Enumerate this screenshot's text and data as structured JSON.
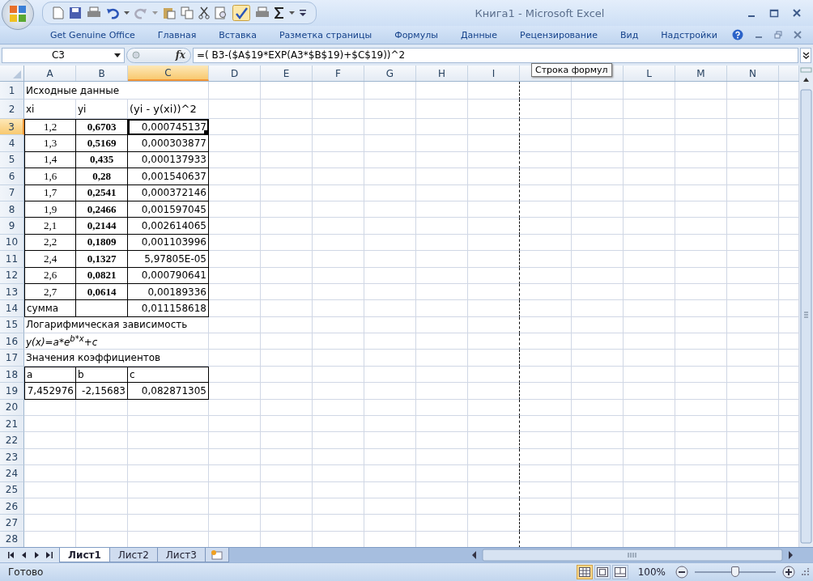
{
  "window": {
    "title": "Книга1 - Microsoft Excel"
  },
  "ribbon_tabs": [
    "Get Genuine Office",
    "Главная",
    "Вставка",
    "Разметка страницы",
    "Формулы",
    "Данные",
    "Рецензирование",
    "Вид",
    "Надстройки"
  ],
  "formula_bar": {
    "name_box": "C3",
    "function_label": "fx",
    "formula": "=( B3-($A$19*EXP(A3*$B$19)+$C$19))^2",
    "tooltip": "Строка формул"
  },
  "columns": [
    {
      "label": "A",
      "selected": false
    },
    {
      "label": "B",
      "selected": false
    },
    {
      "label": "C",
      "selected": true
    },
    {
      "label": "D",
      "selected": false
    },
    {
      "label": "E",
      "selected": false
    },
    {
      "label": "F",
      "selected": false
    },
    {
      "label": "G",
      "selected": false
    },
    {
      "label": "H",
      "selected": false
    },
    {
      "label": "I",
      "selected": false
    },
    {
      "selected": false
    },
    {
      "selected": false
    },
    {
      "label": "L",
      "selected": false
    },
    {
      "label": "M",
      "selected": false
    },
    {
      "label": "N",
      "selected": false
    }
  ],
  "rows": [
    {
      "number": "1",
      "selected": false,
      "bordered": false,
      "cells": [
        {
          "text": "Исходные данные",
          "kind": "text"
        }
      ]
    },
    {
      "number": "2",
      "selected": false,
      "bordered": false,
      "cells": [
        {
          "text": "xi",
          "kind": "text"
        },
        {
          "text": "yi",
          "kind": "text"
        },
        {
          "text": "(yi - y(xi))^2",
          "kind": "header"
        }
      ]
    },
    {
      "number": "3",
      "selected": true,
      "bordered": true,
      "cells": [
        {
          "text": "1,2",
          "kind": "x"
        },
        {
          "text": "0,6703",
          "kind": "y"
        },
        {
          "text": "0,000745137",
          "kind": "num"
        }
      ]
    },
    {
      "number": "4",
      "selected": false,
      "bordered": true,
      "cells": [
        {
          "text": "1,3",
          "kind": "x"
        },
        {
          "text": "0,5169",
          "kind": "y"
        },
        {
          "text": "0,000303877",
          "kind": "num"
        }
      ]
    },
    {
      "number": "5",
      "selected": false,
      "bordered": true,
      "cells": [
        {
          "text": "1,4",
          "kind": "x"
        },
        {
          "text": "0,435",
          "kind": "y"
        },
        {
          "text": "0,000137933",
          "kind": "num"
        }
      ]
    },
    {
      "number": "6",
      "selected": false,
      "bordered": true,
      "cells": [
        {
          "text": "1,6",
          "kind": "x"
        },
        {
          "text": "0,28",
          "kind": "y"
        },
        {
          "text": "0,001540637",
          "kind": "num"
        }
      ]
    },
    {
      "number": "7",
      "selected": false,
      "bordered": true,
      "cells": [
        {
          "text": "1,7",
          "kind": "x"
        },
        {
          "text": "0,2541",
          "kind": "y"
        },
        {
          "text": "0,000372146",
          "kind": "num"
        }
      ]
    },
    {
      "number": "8",
      "selected": false,
      "bordered": true,
      "cells": [
        {
          "text": "1,9",
          "kind": "x"
        },
        {
          "text": "0,2466",
          "kind": "y"
        },
        {
          "text": "0,001597045",
          "kind": "num"
        }
      ]
    },
    {
      "number": "9",
      "selected": false,
      "bordered": true,
      "cells": [
        {
          "text": "2,1",
          "kind": "x"
        },
        {
          "text": "0,2144",
          "kind": "y"
        },
        {
          "text": "0,002614065",
          "kind": "num"
        }
      ]
    },
    {
      "number": "10",
      "selected": false,
      "bordered": true,
      "cells": [
        {
          "text": "2,2",
          "kind": "x"
        },
        {
          "text": "0,1809",
          "kind": "y"
        },
        {
          "text": "0,001103996",
          "kind": "num"
        }
      ]
    },
    {
      "number": "11",
      "selected": false,
      "bordered": true,
      "cells": [
        {
          "text": "2,4",
          "kind": "x"
        },
        {
          "text": "0,1327",
          "kind": "y"
        },
        {
          "text": "5,97805E-05",
          "kind": "num"
        }
      ]
    },
    {
      "number": "12",
      "selected": false,
      "bordered": true,
      "cells": [
        {
          "text": "2,6",
          "kind": "x"
        },
        {
          "text": "0,0821",
          "kind": "y"
        },
        {
          "text": "0,000790641",
          "kind": "num"
        }
      ]
    },
    {
      "number": "13",
      "selected": false,
      "bordered": true,
      "cells": [
        {
          "text": "2,7",
          "kind": "x"
        },
        {
          "text": "0,0614",
          "kind": "y"
        },
        {
          "text": "0,00189336",
          "kind": "num"
        }
      ]
    },
    {
      "number": "14",
      "selected": false,
      "bordered": true,
      "cells": [
        {
          "text": "сумма",
          "kind": "text"
        },
        {},
        {
          "text": "0,011158618",
          "kind": "num"
        }
      ]
    },
    {
      "number": "15",
      "selected": false,
      "bordered": false,
      "cells": [
        {
          "text": "Логарифмическая зависимость",
          "kind": "text"
        }
      ]
    },
    {
      "number": "16",
      "selected": false,
      "bordered": false,
      "cells": [
        {
          "text": "y(x)=a*e$^{b*x}$+c",
          "kind": "formula"
        }
      ]
    },
    {
      "number": "17",
      "selected": false,
      "bordered": false,
      "cells": [
        {
          "text": "Значения коэффициентов",
          "kind": "text"
        }
      ]
    },
    {
      "number": "18",
      "selected": false,
      "bordered": true,
      "cells": [
        {
          "text": "a",
          "kind": "text"
        },
        {
          "text": "b",
          "kind": "text"
        },
        {
          "text": "c",
          "kind": "text"
        }
      ]
    },
    {
      "number": "19",
      "selected": false,
      "bordered": true,
      "cells": [
        {
          "text": "7,452976",
          "kind": "num"
        },
        {
          "text": "-2,15683",
          "kind": "num"
        },
        {
          "text": "0,082871305",
          "kind": "num"
        }
      ]
    },
    {
      "number": "20",
      "selected": false,
      "bordered": false
    },
    {
      "number": "21",
      "selected": false,
      "bordered": false
    },
    {
      "number": "22",
      "selected": false,
      "bordered": false
    },
    {
      "number": "23",
      "selected": false,
      "bordered": false
    },
    {
      "number": "24",
      "selected": false,
      "bordered": false
    },
    {
      "number": "25",
      "selected": false,
      "bordered": false
    },
    {
      "number": "26",
      "selected": false,
      "bordered": false
    },
    {
      "number": "27",
      "selected": false,
      "bordered": false
    },
    {
      "number": "28",
      "selected": false,
      "bordered": false
    }
  ],
  "sheet_tabs": [
    {
      "label": "Лист1",
      "selected": true
    },
    {
      "label": "Лист2",
      "selected": false
    },
    {
      "label": "Лист3",
      "selected": false
    }
  ],
  "status_bar": {
    "text": "Готово",
    "views": [
      {
        "selected": true
      },
      {
        "selected": false
      },
      {
        "selected": false
      }
    ],
    "zoom": "100%",
    "zoom_slider": {
      "level": 0.5
    }
  }
}
